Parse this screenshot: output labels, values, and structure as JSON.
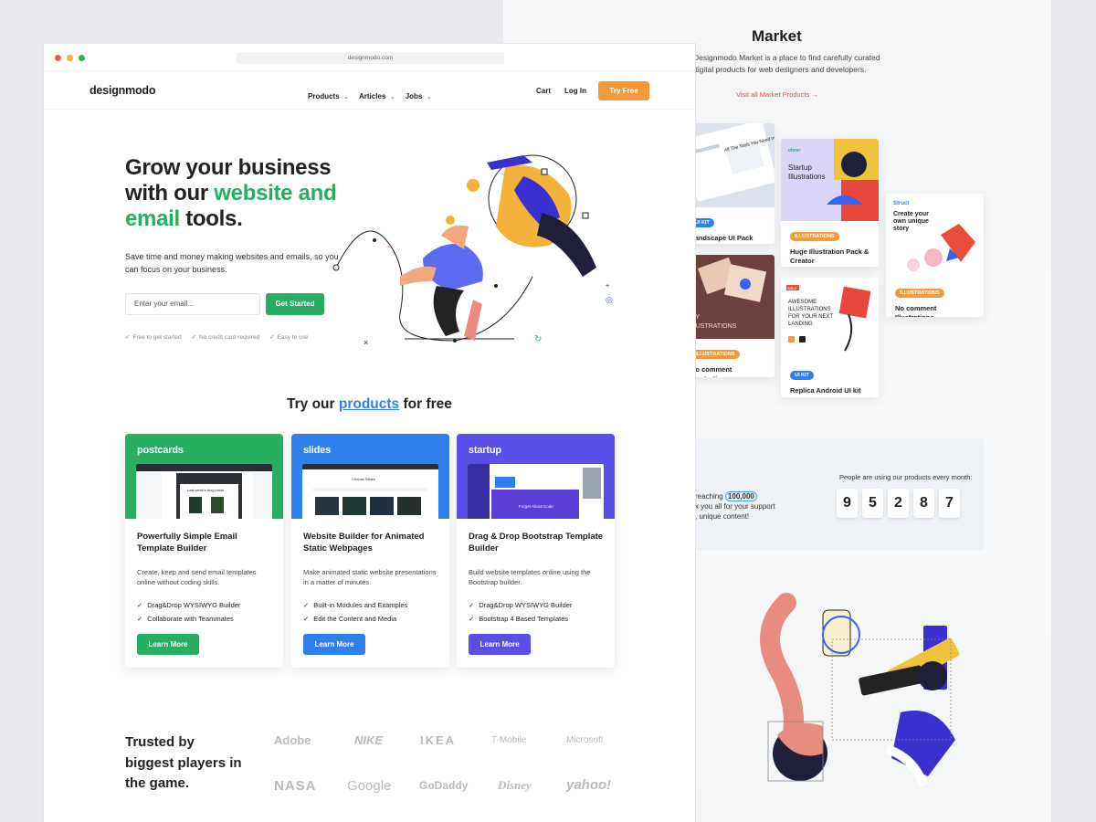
{
  "browser": {
    "url": "designmodo.com"
  },
  "nav": {
    "logo": "designmodo",
    "menu": [
      {
        "label": "Products"
      },
      {
        "label": "Articles"
      },
      {
        "label": "Jobs"
      }
    ],
    "cart": "Cart",
    "login": "Log In",
    "cta": "Try Free"
  },
  "hero": {
    "title_line1": "Grow your business",
    "title_line2a": "with our ",
    "title_line2b": "website and",
    "title_line3a": "email",
    "title_line3b": " tools.",
    "subtitle": "Save time and money making websites and emails, so you can focus on your business.",
    "email_placeholder": "Enter your email...",
    "cta": "Get Started",
    "checks": [
      "Free to get started",
      "No credit card required",
      "Easy to use"
    ]
  },
  "products_section": {
    "title_a": "Try our ",
    "title_b": "products",
    "title_c": " for free",
    "cards": [
      {
        "brand": "postcards",
        "color": "#27ae60",
        "title": "Powerfully Simple Email Template Builder",
        "desc": "Create, keep and send email templates online without coding skills.",
        "features": [
          "Drag&Drop WYSIWYG Builder",
          "Collaborate with Teammates"
        ],
        "button": "Learn More",
        "shot_text": "Last week's blog posts"
      },
      {
        "brand": "slides",
        "color": "#2f80ed",
        "title": "Website Builder for Animated Static Webpages",
        "desc": "Make animated static website presentations in a matter of minutes.",
        "features": [
          "Built-in Modules and Examples",
          "Edit the Content and Media"
        ],
        "button": "Learn More",
        "shot_text": "Choose Slides"
      },
      {
        "brand": "startup",
        "color": "#5b4ee6",
        "title": "Drag & Drop Bootstrap Template Builder",
        "desc": "Build website templates online using the Bootstrap builder.",
        "features": [
          "Drag&Drop WYSIWYG Builder",
          "Bootstrap 4 Based Templates"
        ],
        "button": "Learn More",
        "shot_text": "Forget About Code"
      }
    ]
  },
  "trusted": {
    "title": "Trusted by biggest players in the game.",
    "logos": [
      "Adobe",
      "NIKE",
      "IKEA",
      "T-Mobile",
      "Microsoft",
      "NASA",
      "Google",
      "GoDaddy",
      "Disney",
      "yahoo!"
    ]
  },
  "market": {
    "title": "Market",
    "desc": "Designmodo Market is a place to find carefully curated digital products for web designers and developers.",
    "link": "Visit all Market Products →",
    "cards": [
      {
        "tag": "UI KIT",
        "name": "Landscape UI Pack",
        "tag_color": "#2f80ed",
        "thumb_text": "All The Tools You Need In One Workspace"
      },
      {
        "tag": "ILLUSTRATIONS",
        "name": "Huge Illustration Pack & Creator",
        "tag_color": "#f39a3d",
        "thumb_text": "Startup Illustrations",
        "thumb_brand": "oliver"
      },
      {
        "tag": "ILLUSTRATIONS",
        "name": "No comment Illustrations",
        "tag_color": "#f39a3d",
        "thumb_text": "Create your own unique story",
        "thumb_brand": "Struct"
      },
      {
        "tag": "ILLUSTRATIONS",
        "name": "No comment Illustrations",
        "tag_color": "#f39a3d",
        "thumb_text": "SKY ILLUSTRATIONS"
      },
      {
        "tag": "UI KIT",
        "name": "Replica Android UI kit",
        "tag_color": "#2f80ed",
        "thumb_text": "AWESOME ILLUSTRATIONS FOR YOUR NEXT LANDING",
        "thumb_brand": "ooLo"
      }
    ],
    "stats_label": "People are using our products every month:",
    "digits": [
      "9",
      "5",
      "2",
      "8",
      "7"
    ],
    "stats_text_a": "reaching ",
    "stats_text_hl": "100,000",
    "stats_text_b": "k you all for your support",
    "stats_text_c": ", unique content!"
  }
}
